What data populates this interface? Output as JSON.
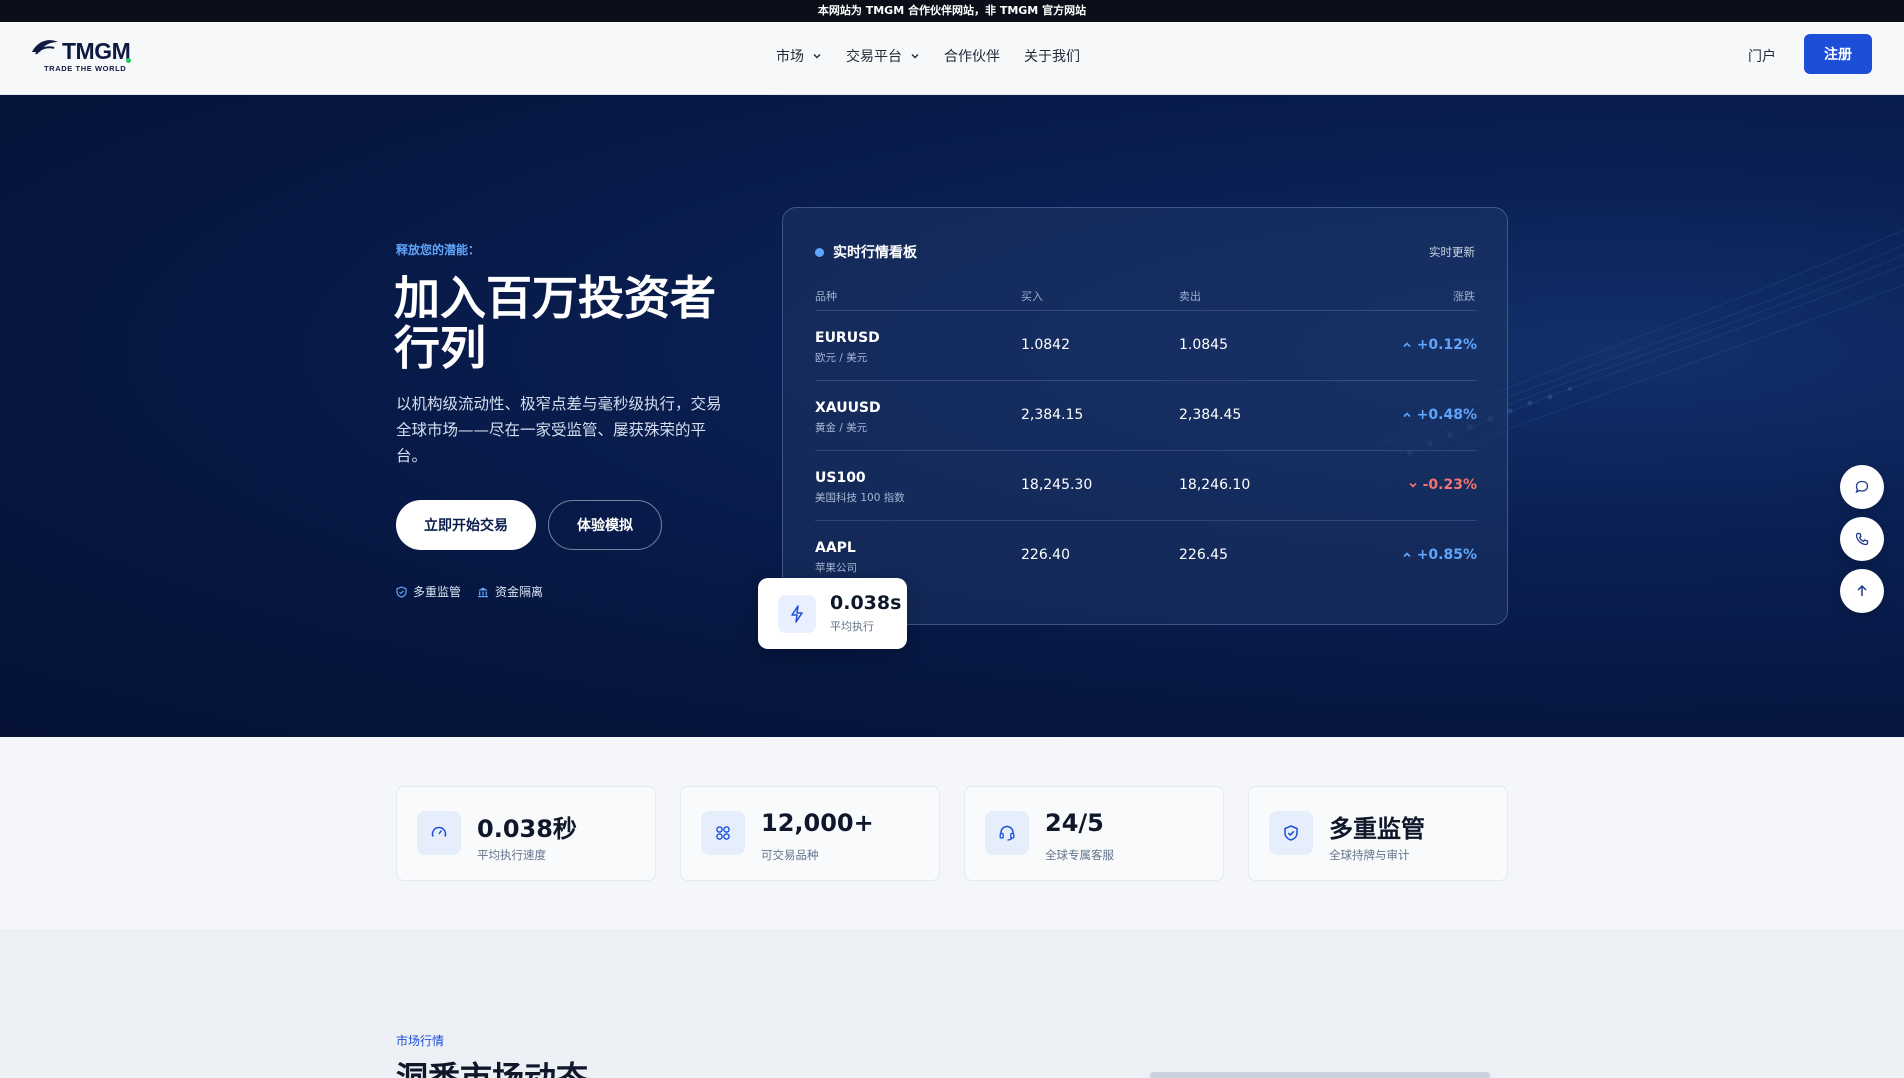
{
  "topbar": {
    "text": "本网站为 TMGM 合作伙伴网站，非 TMGM 官方网站"
  },
  "brand": {
    "name": "TMGM",
    "tagline": "TRADE THE WORLD"
  },
  "nav": {
    "items": [
      {
        "label": "市场",
        "dropdown": true
      },
      {
        "label": "交易平台",
        "dropdown": true
      },
      {
        "label": "合作伙伴",
        "dropdown": false
      },
      {
        "label": "关于我们",
        "dropdown": false
      }
    ],
    "portal": "门户",
    "signup": "注册"
  },
  "hero": {
    "eyebrow": "释放您的潜能：",
    "title": "加入百万投资者行列",
    "subtitle": "以机构级流动性、极窄点差与毫秒级执行，交易全球市场——尽在一家受监管、屡获殊荣的平台。",
    "cta_primary": "立即开始交易",
    "cta_secondary": "体验模拟",
    "badges": [
      "多重监管",
      "资金隔离"
    ]
  },
  "board": {
    "title": "实时行情看板",
    "live": "实时更新",
    "columns": [
      "品种",
      "买入",
      "卖出",
      "涨跌"
    ],
    "rows": [
      {
        "symbol": "EURUSD",
        "name": "欧元 / 美元",
        "bid": "1.0842",
        "ask": "1.0845",
        "change": "+0.12%",
        "direction": "up"
      },
      {
        "symbol": "XAUUSD",
        "name": "黄金 / 美元",
        "bid": "2,384.15",
        "ask": "2,384.45",
        "change": "+0.48%",
        "direction": "up"
      },
      {
        "symbol": "US100",
        "name": "美国科技 100 指数",
        "bid": "18,245.30",
        "ask": "18,246.10",
        "change": "-0.23%",
        "direction": "down"
      },
      {
        "symbol": "AAPL",
        "name": "苹果公司",
        "bid": "226.40",
        "ask": "226.45",
        "change": "+0.85%",
        "direction": "up"
      }
    ]
  },
  "exec_card": {
    "value": "0.038s",
    "label": "平均执行"
  },
  "stats": [
    {
      "value": "0.038秒",
      "label": "平均执行速度",
      "icon": "speedometer-icon"
    },
    {
      "value": "12,000+",
      "label": "可交易品种",
      "icon": "grid-icon"
    },
    {
      "value": "24/5",
      "label": "全球专属客服",
      "icon": "headset-icon"
    },
    {
      "value": "多重监管",
      "label": "全球持牌与审计",
      "icon": "shield-check-icon"
    }
  ],
  "market": {
    "eyebrow": "市场行情",
    "title": "洞悉市场动态"
  },
  "colors": {
    "accent": "#1d4ed8",
    "hero_bg": "#061640",
    "up": "#60a5fa",
    "down": "#f87171"
  }
}
